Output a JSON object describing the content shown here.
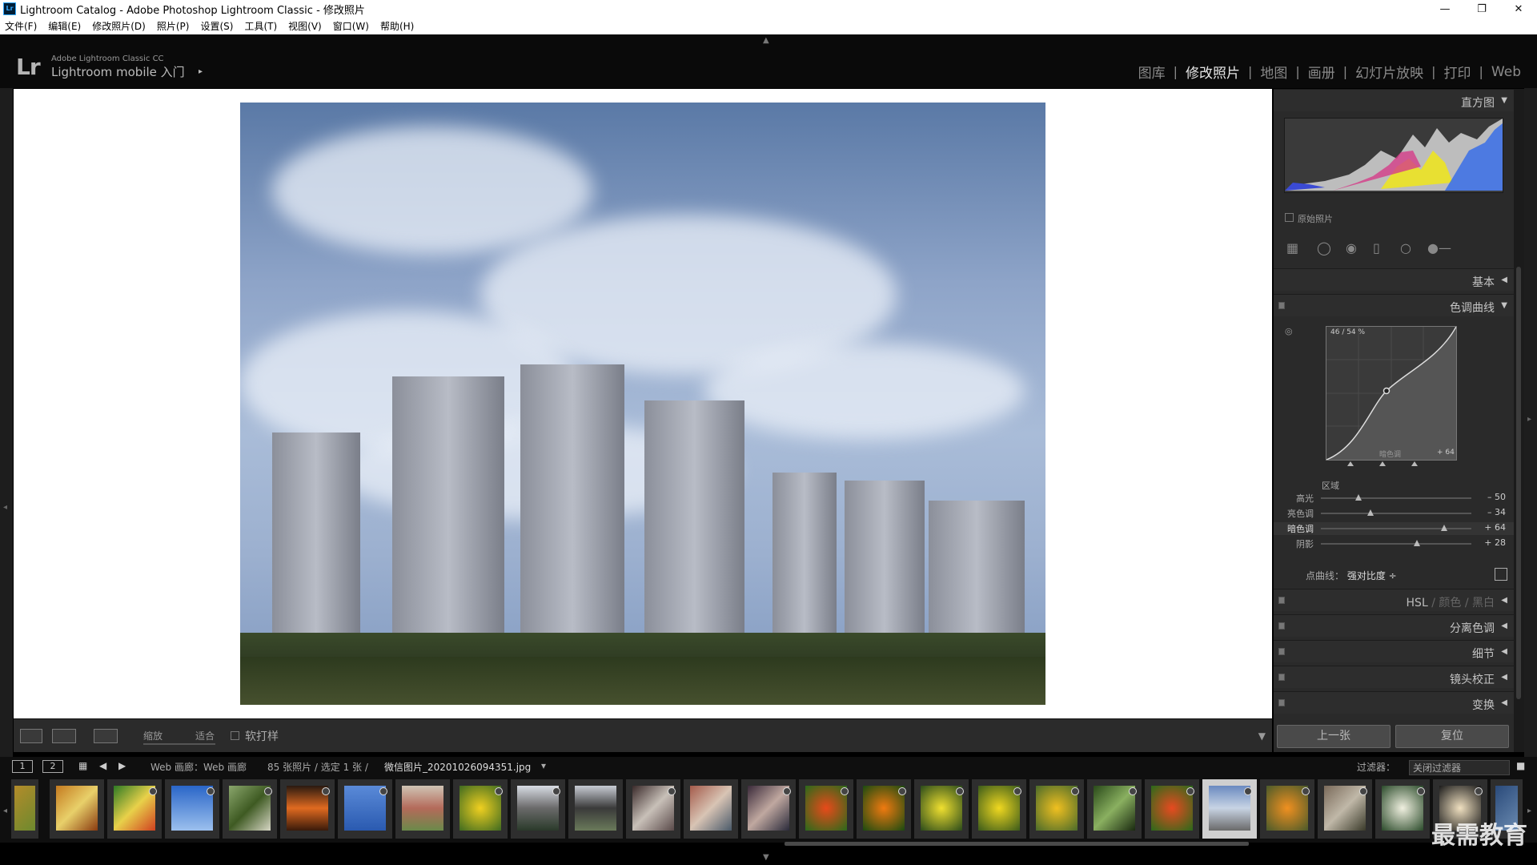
{
  "window": {
    "app_icon": "Lr",
    "title": "Lightroom Catalog - Adobe Photoshop Lightroom Classic - 修改照片",
    "controls": {
      "minimize": "—",
      "restore": "❐",
      "close": "✕"
    }
  },
  "menu": [
    "文件(F)",
    "编辑(E)",
    "修改照片(D)",
    "照片(P)",
    "设置(S)",
    "工具(T)",
    "视图(V)",
    "窗口(W)",
    "帮助(H)"
  ],
  "identity": {
    "logo": "Lr",
    "top": "Adobe Lightroom Classic CC",
    "bottom": "Lightroom mobile 入门",
    "arrow": "▸"
  },
  "modules": [
    "图库",
    "修改照片",
    "地图",
    "画册",
    "幻灯片放映",
    "打印",
    "Web"
  ],
  "active_module": "修改照片",
  "toolbar": {
    "zoom_label": "缩放",
    "fit_label": "适合",
    "softproof_label": "软打样"
  },
  "panels": {
    "histogram": {
      "title": "直方图",
      "original_label": "原始照片"
    },
    "basic": {
      "title": "基本"
    },
    "tone_curve": {
      "title": "色调曲线",
      "readout": "46 / 54 %",
      "region_label": "区域",
      "in_curve_label": "暗色调",
      "in_curve_value": "+ 64",
      "sliders": [
        {
          "label": "高光",
          "value": "– 50",
          "level": -50
        },
        {
          "label": "亮色调",
          "value": "– 34",
          "level": -34
        },
        {
          "label": "暗色调",
          "value": "+ 64",
          "level": 64
        },
        {
          "label": "阴影",
          "value": "+ 28",
          "level": 28
        }
      ],
      "point_curve_label": "点曲线：",
      "point_curve_value": "强对比度 ÷"
    },
    "hsl": {
      "title": "HSL",
      "sep1": "/",
      "color": "颜色",
      "sep2": "/",
      "bw": "黑白"
    },
    "split_toning": {
      "title": "分离色调"
    },
    "detail": {
      "title": "细节"
    },
    "lens": {
      "title": "镜头校正"
    },
    "transform": {
      "title": "变换"
    }
  },
  "buttons": {
    "previous": "上一张",
    "reset": "复位"
  },
  "filmstrip_bar": {
    "page1": "1",
    "page2": "2",
    "source": "Web 画廊：Web 画廊",
    "count": "85 张照片 / 选定 1 张 /",
    "filename": "微信图片_20201026094351.jpg",
    "filter_label": "过滤器：",
    "filter_value": "关闭过滤器"
  },
  "watermark": "最需教育",
  "colors": {
    "accent": "#31a8ff",
    "panel_bg": "#2a2a2a",
    "selected_thumb": "#cfcfcf"
  }
}
